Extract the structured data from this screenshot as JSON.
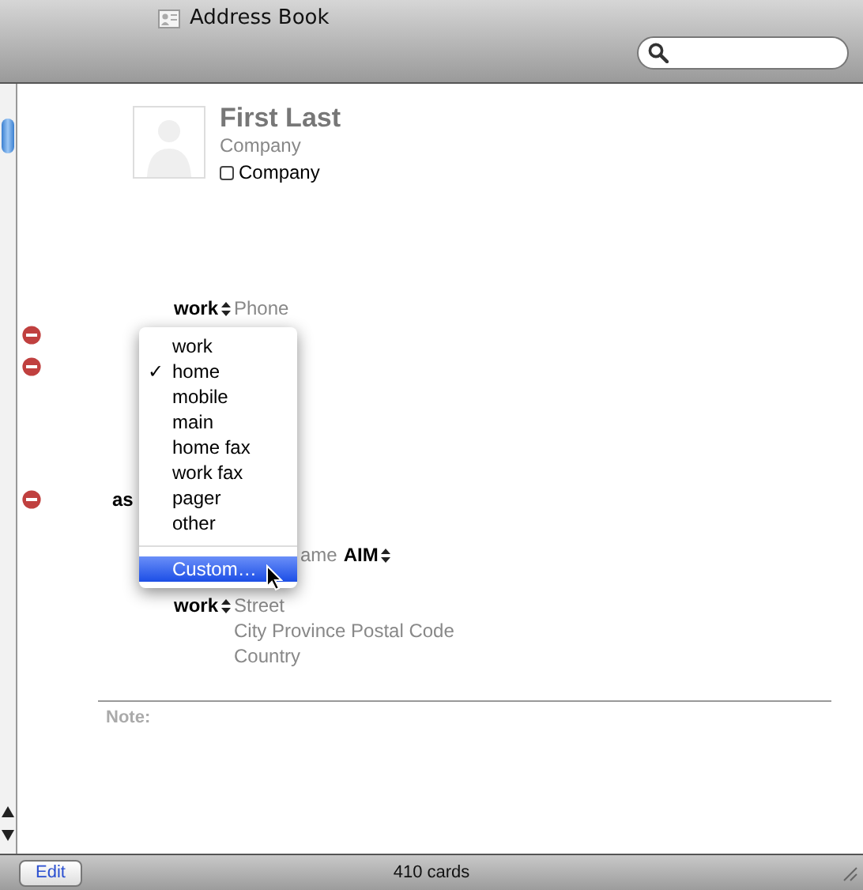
{
  "window": {
    "title": "Address Book"
  },
  "card": {
    "name": "First Last",
    "company": "Company",
    "company_checkbox": {
      "label": "Company",
      "checked": false
    }
  },
  "fields": [
    {
      "kind": "phone",
      "label": "work",
      "value": "Phone"
    },
    {
      "kind": "remove"
    },
    {
      "kind": "remove"
    },
    {
      "kind": "remove",
      "label": "as"
    },
    {
      "kind": "im",
      "value": "ame",
      "service": "AIM"
    },
    {
      "kind": "address",
      "label": "work",
      "lines": [
        "Street",
        "City Province Postal Code",
        "Country"
      ]
    }
  ],
  "note": {
    "label": "Note:"
  },
  "menu": {
    "check_mark": "✓",
    "items": [
      {
        "label": "work",
        "selected": false,
        "highlighted": false
      },
      {
        "label": "home",
        "selected": true,
        "highlighted": false
      },
      {
        "label": "mobile",
        "selected": false,
        "highlighted": false
      },
      {
        "label": "main",
        "selected": false,
        "highlighted": false
      },
      {
        "label": "home fax",
        "selected": false,
        "highlighted": false
      },
      {
        "label": "work fax",
        "selected": false,
        "highlighted": false
      },
      {
        "label": "pager",
        "selected": false,
        "highlighted": false
      },
      {
        "label": "other",
        "selected": false,
        "highlighted": false
      }
    ],
    "custom": {
      "label": "Custom…",
      "selected": false,
      "highlighted": true
    }
  },
  "status_bar": {
    "edit_button": "Edit",
    "count": "410 cards"
  }
}
